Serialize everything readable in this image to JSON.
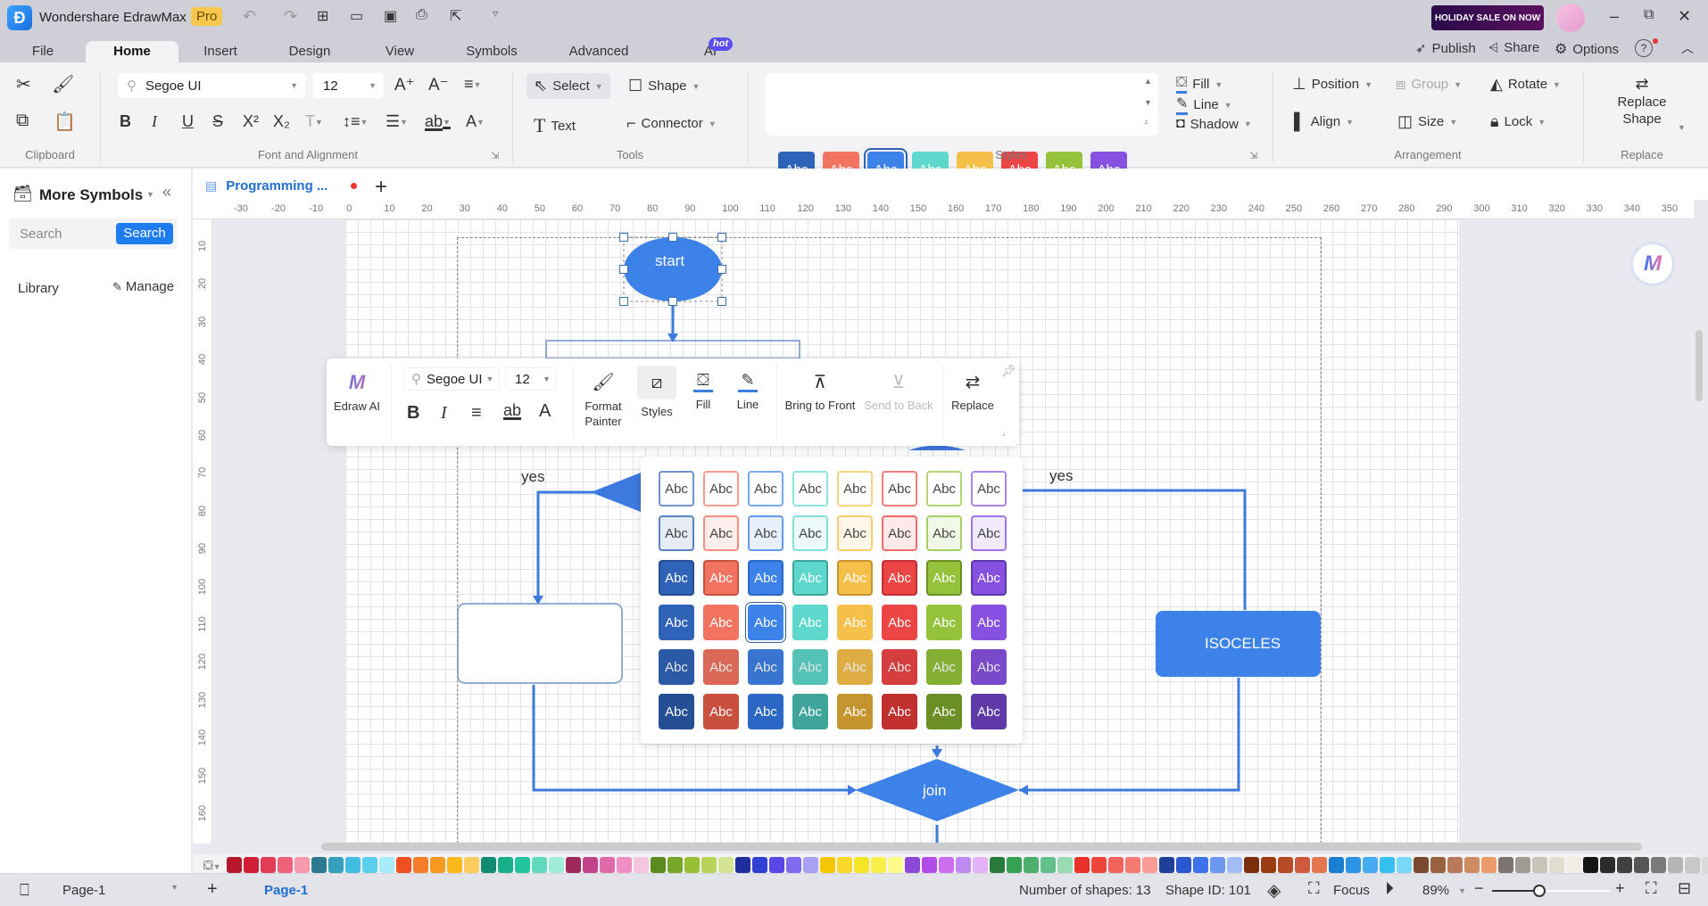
{
  "app": {
    "title": "Wondershare EdrawMax",
    "badge": "Pro",
    "promo": "HOLIDAY SALE ON NOW"
  },
  "quick_access": [
    "undo-icon",
    "redo-icon",
    "new-icon",
    "open-icon",
    "save-icon",
    "print-icon",
    "export-icon",
    "customize-icon"
  ],
  "window_controls": [
    "minimize",
    "restore",
    "close"
  ],
  "menu_tabs": [
    {
      "label": "File"
    },
    {
      "label": "Home",
      "active": true
    },
    {
      "label": "Insert"
    },
    {
      "label": "Design"
    },
    {
      "label": "View"
    },
    {
      "label": "Symbols"
    },
    {
      "label": "Advanced"
    },
    {
      "label": "AI",
      "badge": "hot"
    }
  ],
  "header_actions": {
    "publish": "Publish",
    "share": "Share",
    "options": "Options"
  },
  "ribbon": {
    "groups": {
      "clipboard": "Clipboard",
      "font": "Font and Alignment",
      "tools": "Tools",
      "styles": "Styles",
      "arrangement": "Arrangement",
      "replace": "Replace"
    },
    "font_family": "Segoe UI",
    "font_size": "12",
    "tools": {
      "select": "Select",
      "shape": "Shape",
      "text": "Text",
      "connector": "Connector"
    },
    "style_swatches": [
      {
        "label": "Abc",
        "color": "#2f63b8"
      },
      {
        "label": "Abc",
        "color": "#f2735f"
      },
      {
        "label": "Abc",
        "color": "#3d82e8",
        "selected": true
      },
      {
        "label": "Abc",
        "color": "#5ed8cc"
      },
      {
        "label": "Abc",
        "color": "#f5c04a"
      },
      {
        "label": "Abc",
        "color": "#ec4545"
      },
      {
        "label": "Abc",
        "color": "#94c23a"
      },
      {
        "label": "Abc",
        "color": "#8651e0"
      }
    ],
    "fill": "Fill",
    "line": "Line",
    "shadow": "Shadow",
    "position": "Position",
    "group": "Group",
    "rotate": "Rotate",
    "align": "Align",
    "size": "Size",
    "lock": "Lock",
    "replace_shape": "Replace Shape"
  },
  "sidebar": {
    "title": "More Symbols",
    "search_placeholder": "Search",
    "search_button": "Search",
    "library": "Library",
    "manage": "Manage"
  },
  "document_tab": {
    "label": "Programming ...",
    "unsaved": true
  },
  "ruler": {
    "h": [
      "-30",
      "-20",
      "-10",
      "0",
      "10",
      "20",
      "30",
      "40",
      "50",
      "60",
      "70",
      "80",
      "90",
      "100",
      "110",
      "120",
      "130",
      "140",
      "150",
      "160",
      "170",
      "180",
      "190",
      "200",
      "210",
      "220",
      "230",
      "240",
      "250",
      "260",
      "270",
      "280",
      "290",
      "300",
      "310",
      "320",
      "330",
      "340",
      "350"
    ],
    "v": [
      "10",
      "20",
      "30",
      "40",
      "50",
      "60",
      "70",
      "80",
      "90",
      "100",
      "110",
      "120",
      "130",
      "140",
      "150",
      "160"
    ]
  },
  "diagram": {
    "start": "start",
    "yes_left": "yes",
    "yes_right": "yes",
    "isoceles": "ISOCELES",
    "join": "join"
  },
  "floating_toolbar": {
    "edraw_ai": "Edraw AI",
    "font_family": "Segoe UI",
    "font_size": "12",
    "format_painter": "Format Painter",
    "styles": "Styles",
    "fill": "Fill",
    "line": "Line",
    "bring_to_front": "Bring to Front",
    "send_to_back": "Send to Back",
    "replace": "Replace"
  },
  "style_gallery": {
    "label": "Abc",
    "columns": [
      "#2f63b8",
      "#f2735f",
      "#3d82e8",
      "#5ed8cc",
      "#f5c04a",
      "#ec4545",
      "#94c23a",
      "#8651e0"
    ],
    "dark": [
      "#254f94",
      "#c94f3e",
      "#2b67c4",
      "#3fa59b",
      "#c4952e",
      "#c0302f",
      "#6c8f25",
      "#5f39a8"
    ],
    "selected": {
      "row": 3,
      "col": 2
    }
  },
  "palette": [
    "#b5172b",
    "#d01f35",
    "#e23b56",
    "#ee6178",
    "#f59aab",
    "#2b7a8f",
    "#35a0bc",
    "#40bde0",
    "#5ad0ee",
    "#a8ecfb",
    "#f04e23",
    "#f57c2b",
    "#f69a21",
    "#fbb81b",
    "#fccb5d",
    "#138a72",
    "#19ae8a",
    "#23c4a0",
    "#62dac0",
    "#a1ecd9",
    "#9e2a5c",
    "#c2438a",
    "#e06aa9",
    "#f08fc6",
    "#f5c6df",
    "#5b8a1f",
    "#77a72a",
    "#98c036",
    "#b7d35a",
    "#d5e494",
    "#1e2f9c",
    "#3040d2",
    "#5b46e8",
    "#7f6cee",
    "#a99ff3",
    "#f5c600",
    "#f8d92a",
    "#f4e628",
    "#f8f049",
    "#fdfb8a",
    "#8e48d8",
    "#b24ce8",
    "#cd6df0",
    "#c089ef",
    "#e3b1f6",
    "#2a7a3e",
    "#35a252",
    "#4caf6e",
    "#63c08a",
    "#99dbb3",
    "#e8322a",
    "#ef463a",
    "#f2645b",
    "#f57a72",
    "#f89c95",
    "#1e3f9a",
    "#2b58cf",
    "#3d73ea",
    "#6b97f0",
    "#a2bcf6",
    "#7a2e0a",
    "#9c3c12",
    "#b74a25",
    "#d05a3d",
    "#e2774f",
    "#1a7fd0",
    "#2d95e6",
    "#46abf1",
    "#35c0f0",
    "#7ad8f6",
    "#7a4a30",
    "#9a6140",
    "#b87a5a",
    "#cf8c62",
    "#ed9b6c",
    "#7b756d",
    "#a09c92",
    "#c8c5b8",
    "#e0ddd0",
    "#f0ede5",
    "#151515",
    "#2b2b2b",
    "#404040",
    "#555555",
    "#7a7a7a",
    "#b5b5b5",
    "#c8c8c8",
    "#dadada",
    "#e5e5e5",
    "#f0f0f0"
  ],
  "status": {
    "page_select": "Page-1",
    "page_tab": "Page-1",
    "shapes": "Number of shapes: 13",
    "shape_id": "Shape ID: 101",
    "focus": "Focus",
    "zoom": "89%",
    "zoom_level": 0.4
  }
}
